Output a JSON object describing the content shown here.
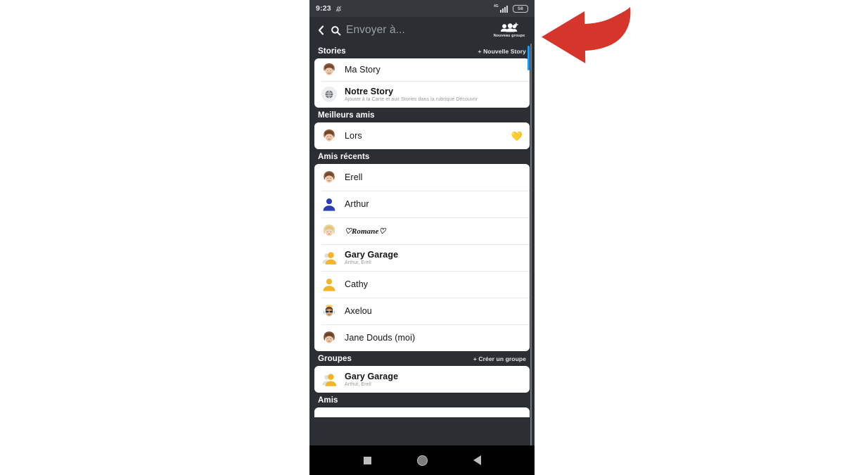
{
  "colors": {
    "phone_bg": "#2b2f33",
    "statusbar_bg": "#35393d",
    "card_bg": "#ffffff",
    "scroll_thumb": "#1e9cf0",
    "arrow": "#d6352b",
    "heart": "#f7c948",
    "arthur_avatar": "#2b3fb5",
    "cathy_avatar": "#f5b425"
  },
  "status_bar": {
    "time": "9:23",
    "bell_icon": "bell-muted-icon",
    "network_label": "4G",
    "signal_icon": "signal-bars-icon",
    "battery_level": "58"
  },
  "header": {
    "back_icon": "back-chevron-icon",
    "search_icon": "search-icon",
    "search_value": "",
    "search_placeholder": "Envoyer à...",
    "new_group_icon": "group-add-icon",
    "new_group_label": "Nouveau groupe"
  },
  "sections": [
    {
      "name": "stories",
      "title": "Stories",
      "action": "+ Nouvelle Story",
      "rows": [
        {
          "name": "ma-story",
          "avatar": "bitmoji-brown-hair",
          "title": "Ma Story",
          "subtitle": "",
          "bold": false,
          "script": false,
          "badge": ""
        },
        {
          "name": "notre-story",
          "avatar": "globe-icon",
          "title": "Notre Story",
          "subtitle": "Ajouter à la Carte et aux Stories dans la rubrique Découvrir",
          "bold": true,
          "script": false,
          "badge": ""
        }
      ]
    },
    {
      "name": "meilleurs-amis",
      "title": "Meilleurs amis",
      "action": "",
      "rows": [
        {
          "name": "lors",
          "avatar": "bitmoji-brown-hair",
          "title": "Lors",
          "subtitle": "",
          "bold": false,
          "script": false,
          "badge": "💛"
        }
      ]
    },
    {
      "name": "amis-recents",
      "title": "Amis récents",
      "action": "",
      "rows": [
        {
          "name": "erell",
          "avatar": "bitmoji-brown-hair",
          "title": "Erell",
          "subtitle": "",
          "bold": false,
          "script": false,
          "badge": ""
        },
        {
          "name": "arthur",
          "avatar": "silhouette-blue",
          "title": "Arthur",
          "subtitle": "",
          "bold": false,
          "script": false,
          "badge": ""
        },
        {
          "name": "romane",
          "avatar": "bitmoji-blonde",
          "title": "♡Romane♡",
          "subtitle": "",
          "bold": false,
          "script": true,
          "badge": ""
        },
        {
          "name": "gary-garage",
          "avatar": "group-silhouettes",
          "title": "Gary Garage",
          "subtitle": "Arthur, Erell",
          "bold": true,
          "script": false,
          "badge": ""
        },
        {
          "name": "cathy",
          "avatar": "silhouette-yellow",
          "title": "Cathy",
          "subtitle": "",
          "bold": false,
          "script": false,
          "badge": ""
        },
        {
          "name": "axelou",
          "avatar": "bitmoji-sunglasses",
          "title": "Axelou",
          "subtitle": "",
          "bold": false,
          "script": false,
          "badge": ""
        },
        {
          "name": "jane-douds",
          "avatar": "bitmoji-brown-hair",
          "title": "Jane Douds (moi)",
          "subtitle": "",
          "bold": false,
          "script": false,
          "badge": ""
        }
      ]
    },
    {
      "name": "groupes",
      "title": "Groupes",
      "action": "+ Créer un groupe",
      "rows": [
        {
          "name": "gary-garage-group",
          "avatar": "group-silhouettes",
          "title": "Gary Garage",
          "subtitle": "Arthur, Erell",
          "bold": true,
          "script": false,
          "badge": ""
        }
      ]
    },
    {
      "name": "amis",
      "title": "Amis",
      "action": "",
      "rows": []
    }
  ],
  "nav_bar": {
    "recents_icon": "square-recents-icon",
    "home_icon": "circle-home-icon",
    "back_icon": "triangle-back-icon"
  },
  "annotation": {
    "arrow_icon": "curved-arrow-left-icon"
  }
}
